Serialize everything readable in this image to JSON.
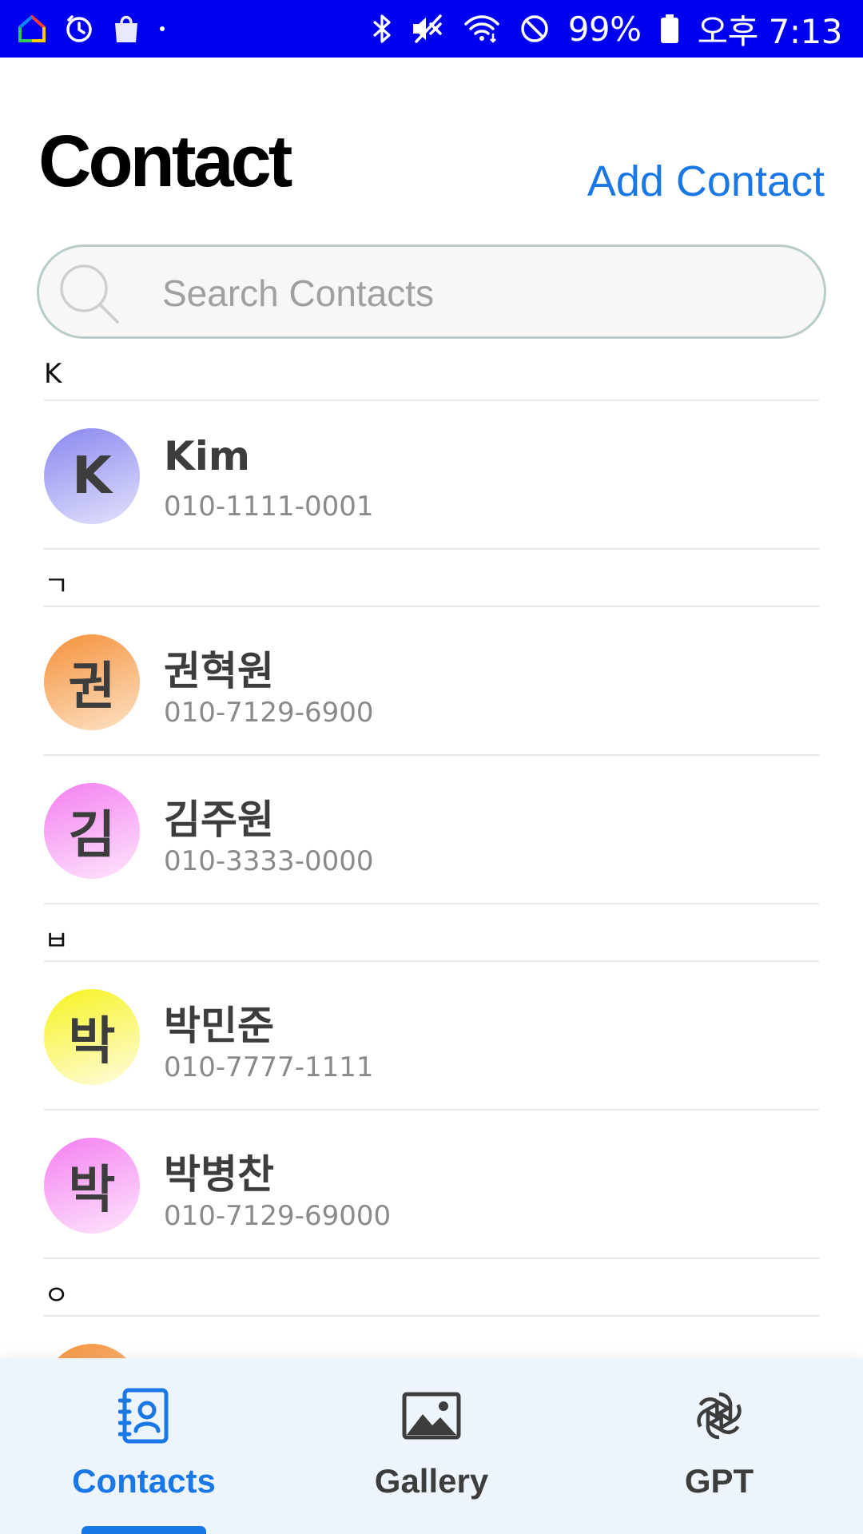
{
  "status_bar": {
    "battery": "99%",
    "time": "오후 7:13",
    "icons": [
      "home-color-icon",
      "timer-icon",
      "shopping-bag-icon",
      "dot-icon",
      "bluetooth-icon",
      "vibrate-off-icon",
      "wifi-icon",
      "do-not-disturb-icon",
      "battery-icon"
    ]
  },
  "header": {
    "title": "Contact",
    "add_contact_label": "Add Contact"
  },
  "search": {
    "placeholder": "Search Contacts"
  },
  "sections": [
    {
      "letter": "K",
      "contacts": [
        {
          "initial": "K",
          "name": "Kim",
          "phone": "010-1111-0001",
          "color_top": "#8a87f0",
          "color_bottom": "#e2e2fb"
        }
      ]
    },
    {
      "letter": "ㄱ",
      "contacts": [
        {
          "initial": "권",
          "name": "권혁원",
          "phone": "010-7129-6900",
          "color_top": "#f5913a",
          "color_bottom": "#fde2c6"
        },
        {
          "initial": "김",
          "name": "김주원",
          "phone": "010-3333-0000",
          "color_top": "#f47ff0",
          "color_bottom": "#fde6fc"
        }
      ]
    },
    {
      "letter": "ㅂ",
      "contacts": [
        {
          "initial": "박",
          "name": "박민준",
          "phone": "010-7777-1111",
          "color_top": "#f6f31e",
          "color_bottom": "#fffce0"
        },
        {
          "initial": "박",
          "name": "박병찬",
          "phone": "010-7129-69000",
          "color_top": "#f47ff0",
          "color_bottom": "#fde6fc"
        }
      ]
    },
    {
      "letter": "ㅇ",
      "contacts": []
    }
  ],
  "bottom_nav": {
    "tabs": [
      {
        "label": "Contacts",
        "icon": "contacts-book-icon",
        "active": true
      },
      {
        "label": "Gallery",
        "icon": "image-icon",
        "active": false
      },
      {
        "label": "GPT",
        "icon": "openai-logo-icon",
        "active": false
      }
    ]
  },
  "colors": {
    "status_bar": "#0000f0",
    "accent": "#1977e6",
    "nav_background": "#eef4fc"
  }
}
